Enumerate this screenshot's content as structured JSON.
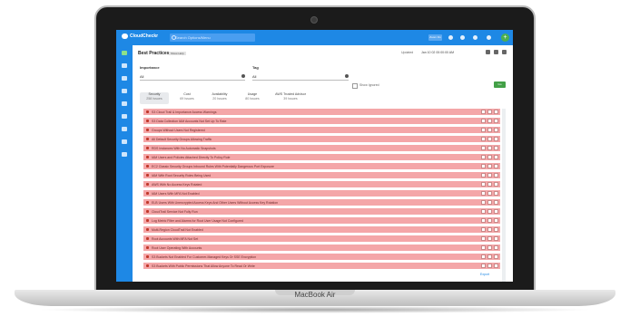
{
  "device": {
    "label": "MacBook Air"
  },
  "app": {
    "name": "CloudCheckr",
    "search_placeholder": "Search Options/Menu",
    "top_button": "Zoom Fix",
    "sidebar_icons": [
      "list-icon",
      "grid-icon",
      "cloud-icon",
      "shield-icon",
      "dollar-icon",
      "chart-icon",
      "tag-icon",
      "mail-icon",
      "settings-icon"
    ]
  },
  "page": {
    "title": "Best Practices",
    "tag": "Show Help",
    "date_label": "Updated",
    "date_value": "Jan 10 02 00:00:00 AM",
    "filters": {
      "importance_label": "Importance",
      "importance_value": "All",
      "tag_label": "Tag",
      "tag_value": "All",
      "show_ignored": "Show Ignored",
      "go": "Go"
    },
    "tabs": [
      {
        "label": "Security",
        "count": "258 Issues"
      },
      {
        "label": "Cost",
        "count": "69 Issues"
      },
      {
        "label": "Availability",
        "count": "20 Issues"
      },
      {
        "label": "Usage",
        "count": "80 Issues"
      },
      {
        "label": "AWS Trusted Advisor",
        "count": "39 Issues"
      }
    ],
    "rows": [
      "S3 Cloud Trail & Importance Access Warnings",
      "S3 Data Collection IAM Accounts Not Set Up To Rate",
      "Groups Without Users Not Registered",
      "All Default Security Groups Allowing Traffic",
      "RDS Instances With No Automatic Snapshots",
      "IAM Users and Policies Attached Directly To Policy Role",
      "EC2 Classic Security Groups Inbound Rules With Potentially Dangerous Port Exposure",
      "IAM With Root Security Roles Being Used",
      "AWS With No Access Keys Rotated",
      "IAM Users With MFA Not Enabled",
      "ELB Users With Unencrypted Access Keys And Other Users Without Access Key Rotation",
      "CloudTrail Service Not Fully Run",
      "Log Metric Filter and Alarms for Root User Usage Not Configured",
      "Multi-Region CloudTrail Not Enabled",
      "Root Accounts With MFA Not Set",
      "Root User Operating With Accounts",
      "S3 Buckets Not Enabled For Customer-Managed Keys Or SSE Encryption",
      "S3 Buckets With Public Permissions That Allow Anyone To Read Or Write"
    ],
    "more_link": "Export"
  }
}
